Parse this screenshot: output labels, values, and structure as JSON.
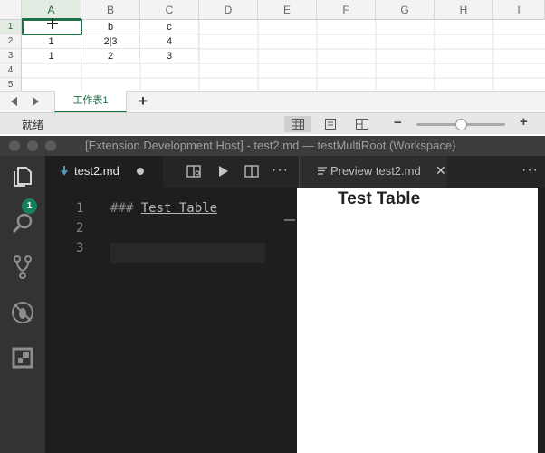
{
  "spreadsheet": {
    "columns": [
      "A",
      "B",
      "C",
      "D",
      "E",
      "F",
      "G",
      "H",
      "I"
    ],
    "rows": [
      "1",
      "2",
      "3",
      "4",
      "5"
    ],
    "cells": [
      [
        "",
        "b",
        "c"
      ],
      [
        "1",
        "2|3",
        "4"
      ],
      [
        "1",
        "2",
        "3"
      ]
    ],
    "sheet_tab": "工作表1",
    "add_sheet_label": "+",
    "status_text": "就绪",
    "zoom_minus": "−",
    "zoom_plus": "+",
    "zoom_level": 0.5,
    "accent_color": "#1e7145"
  },
  "vscode": {
    "window_title": "[Extension Development Host] - test2.md — testMultiRoot (Workspace)",
    "activity_badge": "1",
    "editor": {
      "tab_label": "test2.md",
      "line_numbers": [
        "1",
        "2",
        "3"
      ],
      "line1_prefix": "### ",
      "line1_heading": "Test Table"
    },
    "preview": {
      "tab_label": "Preview test2.md",
      "close_label": "✕",
      "more_label": "···",
      "heading": "Test Table"
    },
    "editor_more_label": "···",
    "icons": [
      "explorer-icon",
      "search-icon",
      "source-control-icon",
      "debug-icon",
      "extensions-icon"
    ]
  }
}
